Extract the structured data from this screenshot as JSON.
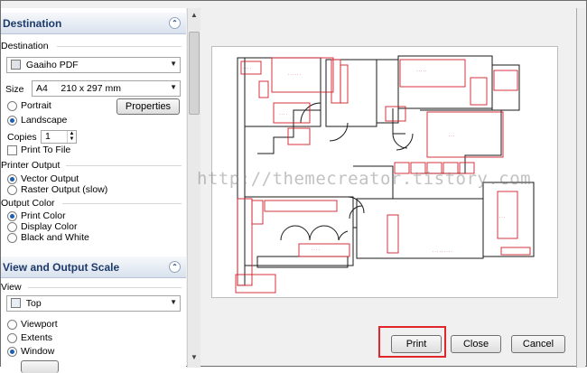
{
  "destination": {
    "title": "Destination",
    "group_label": "Destination",
    "printer": "Gaaiho PDF",
    "size_label": "Size",
    "size_value": "A4     210 x 297 mm",
    "orientation": [
      {
        "label": "Portrait",
        "selected": false
      },
      {
        "label": "Landscape",
        "selected": true
      }
    ],
    "properties_button": "Properties",
    "copies_label": "Copies",
    "copies_value": "1",
    "print_to_file": "Print To File",
    "printer_output_label": "Printer Output",
    "printer_output": [
      {
        "label": "Vector Output",
        "selected": true
      },
      {
        "label": "Raster Output (slow)",
        "selected": false
      }
    ],
    "output_color_label": "Output Color",
    "output_color": [
      {
        "label": "Print Color",
        "selected": true
      },
      {
        "label": "Display Color",
        "selected": false
      },
      {
        "label": "Black and White",
        "selected": false
      }
    ]
  },
  "view_scale": {
    "title": "View and Output Scale",
    "view_label": "View",
    "view_value": "Top",
    "options": [
      {
        "label": "Viewport",
        "selected": false
      },
      {
        "label": "Extents",
        "selected": false
      },
      {
        "label": "Window",
        "selected": true
      }
    ]
  },
  "preview": {
    "watermark": "http://themecreator.tistory.com"
  },
  "buttons": {
    "print": "Print",
    "close": "Close",
    "cancel": "Cancel"
  },
  "colors": {
    "highlight": "#e0262b",
    "header_text": "#1d3a6b",
    "plan_red": "#d0202a"
  }
}
